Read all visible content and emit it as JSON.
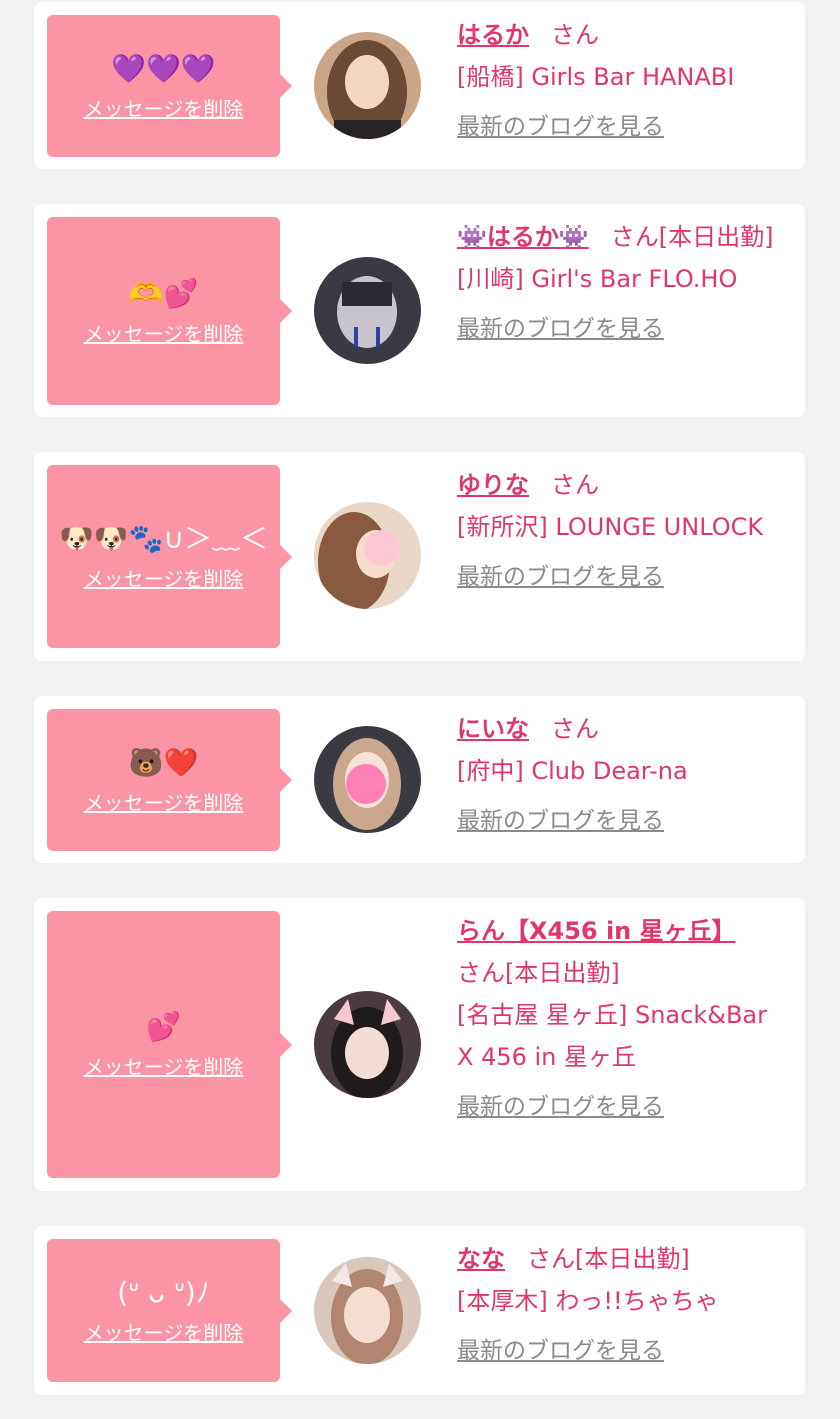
{
  "accent_color": "#e0376a",
  "bubble_color": "#fb94a4",
  "delete_label": "メッセージを削除",
  "blog_label": "最新のブログを見る",
  "cards": [
    {
      "message": "💜💜💜",
      "name": "はるか",
      "san": "さん",
      "status": "",
      "shop": "[船橋] Girls Bar HANABI",
      "avatar_icon": "avatar-photo"
    },
    {
      "message": "🫶💕",
      "name": "👾はるか👾",
      "san": "さん",
      "status": "[本日出勤]",
      "shop": "[川崎] Girl's Bar FLO.HO",
      "avatar_icon": "avatar-photo"
    },
    {
      "message": "🐶🐶🐾∪＞﹏＜",
      "name": "ゆりな",
      "san": "さん",
      "status": "",
      "shop": "[新所沢] LOUNGE UNLOCK",
      "avatar_icon": "avatar-photo"
    },
    {
      "message": "🐻❤️",
      "name": "にいな",
      "san": "さん",
      "status": "",
      "shop": "[府中] Club Dear-na",
      "avatar_icon": "avatar-photo"
    },
    {
      "message": "💕",
      "name": "らん【X456 in 星ヶ丘】",
      "san": "さん",
      "status": "[本日出勤]",
      "shop": "[名古屋 星ヶ丘] Snack&Bar X 456 in 星ヶ丘",
      "avatar_icon": "avatar-photo"
    },
    {
      "message": "(ᐡ ᴗ ᐡ)ﾉ",
      "name": "なな",
      "san": "さん",
      "status": "[本日出勤]",
      "shop": "[本厚木] わっ!!ちゃちゃ",
      "avatar_icon": "avatar-photo"
    }
  ]
}
